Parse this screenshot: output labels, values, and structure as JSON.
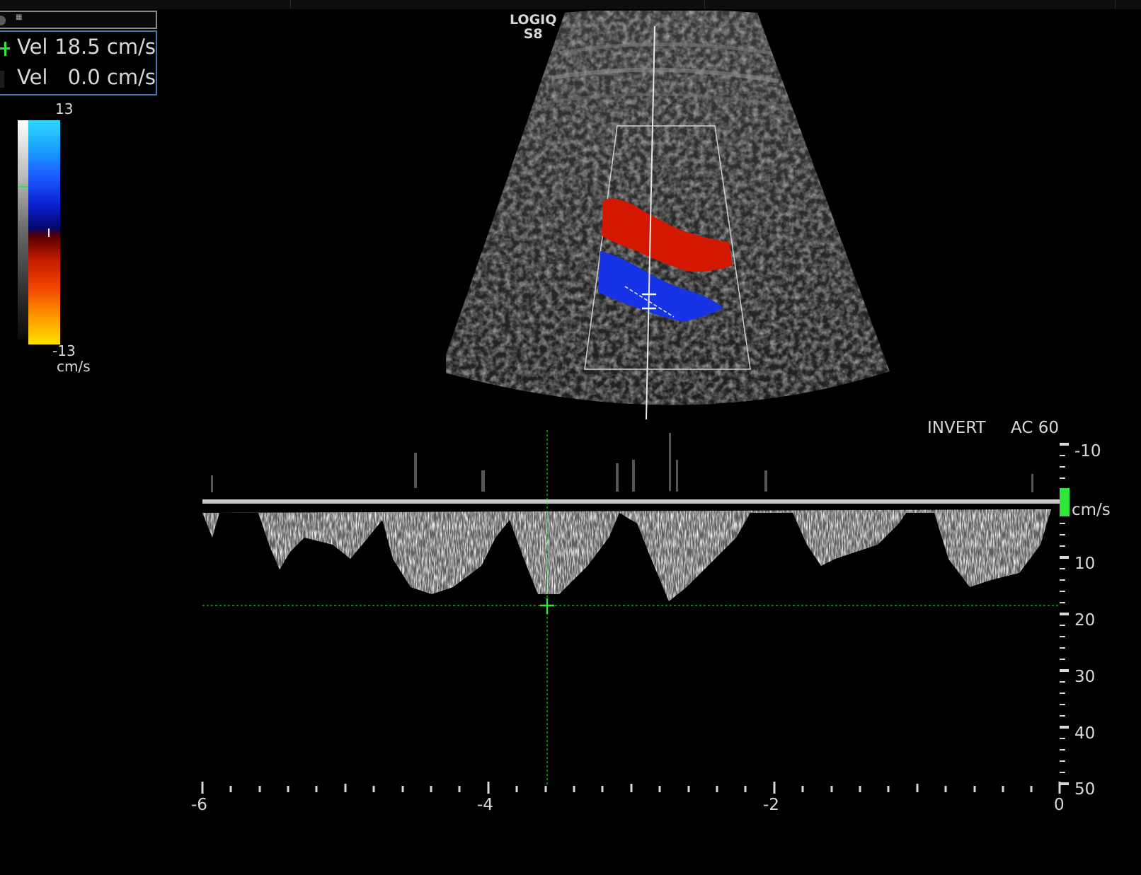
{
  "measurements": {
    "header_text": "",
    "rows": [
      {
        "label": "Vel",
        "value": "18.5 cm/s",
        "marker": "green-crosshair"
      },
      {
        "label": "Vel",
        "value": "0.0 cm/s",
        "marker": "none"
      }
    ]
  },
  "color_scale": {
    "top": "13",
    "bottom": "-13",
    "unit": "cm/s",
    "colors": {
      "positive": "#1a5cff",
      "negative": "#f24700"
    }
  },
  "brand": {
    "line1": "LOGIQ",
    "line2": "S8"
  },
  "spectral": {
    "invert_label": "INVERT",
    "ac_label": "AC 60",
    "velocity_unit": "cm/s",
    "velocity_ticks": [
      "-10",
      "10",
      "20",
      "30",
      "40",
      "50"
    ],
    "time_ticks": [
      "-6",
      "-4",
      "-2",
      "0"
    ],
    "cursor_velocity": 18.5,
    "cursor_color": "#2ee63a"
  }
}
